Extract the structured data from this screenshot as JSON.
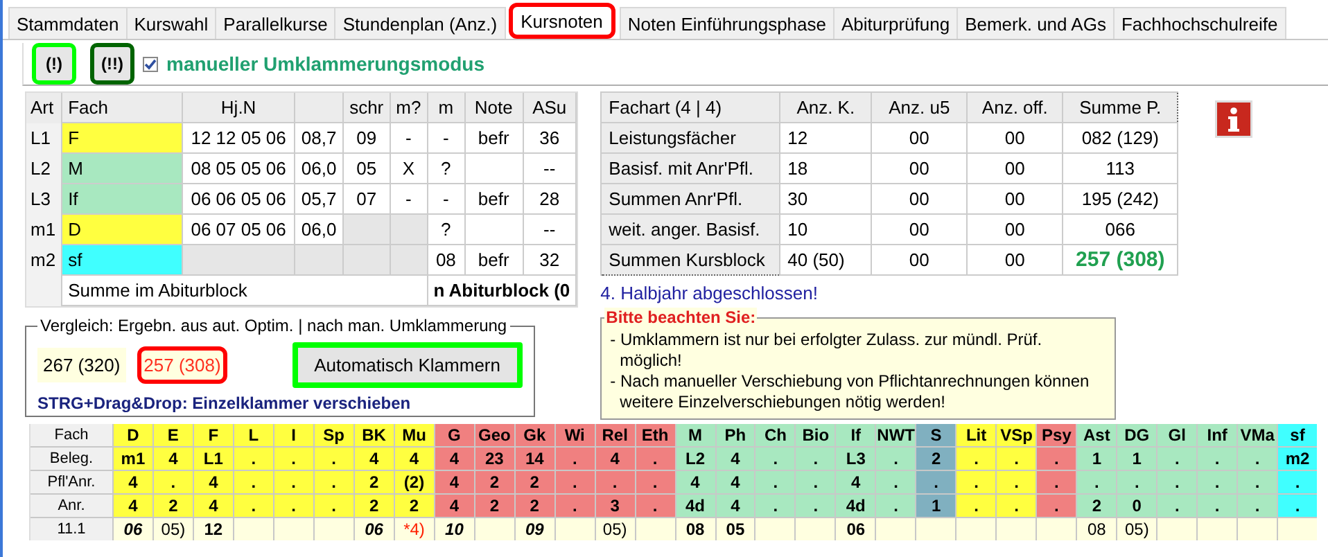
{
  "tabs": [
    {
      "label": "Stammdaten",
      "selected": false
    },
    {
      "label": "Kurswahl",
      "selected": false
    },
    {
      "label": "Parallelkurse",
      "selected": false
    },
    {
      "label": "Stundenplan (Anz.)",
      "selected": false
    },
    {
      "label": "Kursnoten",
      "selected": true,
      "color": "#ff0000"
    },
    {
      "label": "Noten Einführungsphase",
      "selected": false
    },
    {
      "label": "Abiturprüfung",
      "selected": false
    },
    {
      "label": "Bemerk. und AGs",
      "selected": false
    },
    {
      "label": "Fachhochschulreife",
      "selected": false
    }
  ],
  "toolbar": {
    "buttons": [
      {
        "label": "(!)",
        "color": "#00ff00"
      },
      {
        "label": "(!!)",
        "color": "#006400"
      }
    ],
    "mode": {
      "label": "manueller Umklammerungsmodus",
      "checked": true
    }
  },
  "subjects": {
    "columns": [
      "Art",
      "Fach",
      "Hj.N",
      "",
      "schr",
      "m?",
      "m",
      "Note",
      "ASu"
    ],
    "rows": [
      {
        "color": "#ffff40",
        "cells": [
          "L1",
          "F",
          "12 12 05 06",
          "08,7",
          "09",
          "-",
          "-",
          "befr",
          "36"
        ]
      },
      {
        "color": "#a8e8c0",
        "cells": [
          "L2",
          "M",
          "08 05 05 06",
          "06,0",
          "05",
          "X",
          "?",
          null,
          "--"
        ]
      },
      {
        "color": "#a8e8c0",
        "cells": [
          "L3",
          "If",
          "06 06 05 06",
          "05,7",
          "07",
          "-",
          "-",
          "befr",
          "28"
        ]
      },
      {
        "color": "#ffff40",
        "cells": [
          "m1",
          "D",
          "06 07 05 06",
          "06,0",
          {
            "locked": true
          },
          {
            "locked": true
          },
          "?",
          null,
          "--"
        ]
      },
      {
        "color": "#40ffff",
        "cells": [
          "m2",
          "sf",
          {
            "locked": true
          },
          {
            "locked": true
          },
          {
            "locked": true
          },
          {
            "locked": true
          },
          "08",
          "befr",
          "32"
        ]
      }
    ],
    "footer": {
      "label": "Summe im Abiturblock",
      "value": "n Abiturblock (0"
    }
  },
  "summary": {
    "columns": [
      "Fachart  (4 | 4)",
      "Anz. K.",
      "Anz. u5",
      "Anz. off.",
      "Summe P."
    ],
    "rows": [
      {
        "cells": [
          "Leistungsfächer",
          "12",
          "00",
          "00",
          "082 (129)"
        ],
        "emphasized": false
      },
      {
        "cells": [
          "Basisf. mit Anr'Pfl.",
          "18",
          "00",
          "00",
          "113"
        ],
        "emphasized": false
      },
      {
        "cells": [
          "Summen Anr'Pfl.",
          "30",
          "00",
          "00",
          "195 (242)"
        ],
        "emphasized": false
      },
      {
        "cells": [
          "weit. anger. Basisf.",
          "10",
          "00",
          "00",
          "066"
        ],
        "emphasized": false
      },
      {
        "cells": [
          "Summen Kursblock",
          "40 (50)",
          "00",
          "00",
          "257 (308)"
        ],
        "emphasized": true
      }
    ]
  },
  "status": "4. Halbjahr abgeschlossen!",
  "compare": {
    "title": "Vergleich: Ergebn. aus aut. Optim. | nach man. Umklammerung",
    "auto": "267 (320)",
    "manual": {
      "text": "257 (308)",
      "color": "#ff0000"
    },
    "button": {
      "label": "Automatisch Klammern",
      "color": "#00ff00"
    },
    "hint": "STRG+Drag&Drop: Einzelklammer verschieben"
  },
  "notice": {
    "title": "Bitte beachten Sie:",
    "lines": [
      "- Umklammern ist nur bei erfolgter Zulass. zur mündl. Prüf. möglich!",
      "- Nach manueller Verschiebung von Pflichtanrechnungen können weitere Einzelverschiebungen nötig werden!"
    ]
  },
  "grid": {
    "row_labels": [
      "Fach",
      "Beleg.",
      "Pfl'Anr.",
      "Anr.",
      "11.1"
    ],
    "columns": [
      {
        "name": "D",
        "color": "#ffff40",
        "values": [
          "m1",
          "4",
          "4"
        ],
        "h11": {
          "text": "06",
          "kind": "bold-italic"
        }
      },
      {
        "name": "E",
        "color": "#ffff40",
        "values": [
          "4",
          ".",
          "2"
        ],
        "h11": {
          "text": "05)",
          "kind": "plain"
        }
      },
      {
        "name": "F",
        "color": "#ffff40",
        "values": [
          "L1",
          "4",
          "4"
        ],
        "h11": {
          "text": "12",
          "kind": "bold"
        }
      },
      {
        "name": "L",
        "color": "#ffff40",
        "values": [
          ".",
          ".",
          "."
        ]
      },
      {
        "name": "I",
        "color": "#ffff40",
        "values": [
          ".",
          ".",
          "."
        ]
      },
      {
        "name": "Sp",
        "color": "#ffff40",
        "values": [
          ".",
          ".",
          "."
        ]
      },
      {
        "name": "BK",
        "color": "#ffff40",
        "values": [
          "4",
          "2",
          "2"
        ],
        "h11": {
          "text": "06",
          "kind": "bold-italic"
        }
      },
      {
        "name": "Mu",
        "color": "#ffff40",
        "values": [
          "4",
          "(2)",
          "2"
        ],
        "h11": {
          "text": "*4)",
          "kind": "warning"
        }
      },
      {
        "name": "G",
        "color": "#f08080",
        "values": [
          "4",
          "4",
          "4"
        ],
        "h11": {
          "text": "10",
          "kind": "bold-italic"
        }
      },
      {
        "name": "Geo",
        "color": "#f08080",
        "values": [
          "23",
          "2",
          "2"
        ]
      },
      {
        "name": "Gk",
        "color": "#f08080",
        "values": [
          "14",
          "2",
          "2"
        ],
        "h11": {
          "text": "09",
          "kind": "bold-italic"
        }
      },
      {
        "name": "Wi",
        "color": "#f08080",
        "values": [
          ".",
          ".",
          "."
        ]
      },
      {
        "name": "Rel",
        "color": "#f08080",
        "values": [
          "4",
          ".",
          "3"
        ],
        "h11": {
          "text": "05)",
          "kind": "plain"
        }
      },
      {
        "name": "Eth",
        "color": "#f08080",
        "values": [
          ".",
          ".",
          "."
        ]
      },
      {
        "name": "M",
        "color": "#a8e8c0",
        "values": [
          "L2",
          "4",
          "4d"
        ],
        "h11": {
          "text": "08",
          "kind": "bold"
        }
      },
      {
        "name": "Ph",
        "color": "#a8e8c0",
        "values": [
          "4",
          "4",
          "4"
        ],
        "h11": {
          "text": "05",
          "kind": "bold"
        }
      },
      {
        "name": "Ch",
        "color": "#a8e8c0",
        "values": [
          ".",
          ".",
          "."
        ]
      },
      {
        "name": "Bio",
        "color": "#a8e8c0",
        "values": [
          ".",
          ".",
          "."
        ]
      },
      {
        "name": "If",
        "color": "#a8e8c0",
        "values": [
          "L3",
          "4",
          "4d"
        ],
        "h11": {
          "text": "06",
          "kind": "bold"
        }
      },
      {
        "name": "NWT",
        "color": "#a8e8c0",
        "values": [
          ".",
          ".",
          "."
        ]
      },
      {
        "name": "S",
        "color": "#80b0c0",
        "values": [
          "2",
          ".",
          "1"
        ]
      },
      {
        "name": "Lit",
        "color": "#ffff40",
        "values": [
          ".",
          ".",
          "."
        ]
      },
      {
        "name": "VSp",
        "color": "#ffff40",
        "values": [
          ".",
          ".",
          "."
        ]
      },
      {
        "name": "Psy",
        "color": "#f08080",
        "values": [
          ".",
          ".",
          "."
        ]
      },
      {
        "name": "Ast",
        "color": "#a8e8c0",
        "values": [
          "1",
          ".",
          "2"
        ],
        "h11": {
          "text": "08",
          "kind": "plain"
        }
      },
      {
        "name": "DG",
        "color": "#a8e8c0",
        "values": [
          "1",
          ".",
          "0"
        ],
        "h11": {
          "text": "05)",
          "kind": "plain"
        }
      },
      {
        "name": "Gl",
        "color": "#a8e8c0",
        "values": [
          ".",
          ".",
          "."
        ]
      },
      {
        "name": "Inf",
        "color": "#a8e8c0",
        "values": [
          ".",
          ".",
          "."
        ]
      },
      {
        "name": "VMa",
        "color": "#a8e8c0",
        "values": [
          ".",
          ".",
          "."
        ]
      },
      {
        "name": "sf",
        "color": "#40ffff",
        "values": [
          "m2",
          ".",
          "."
        ]
      }
    ]
  }
}
